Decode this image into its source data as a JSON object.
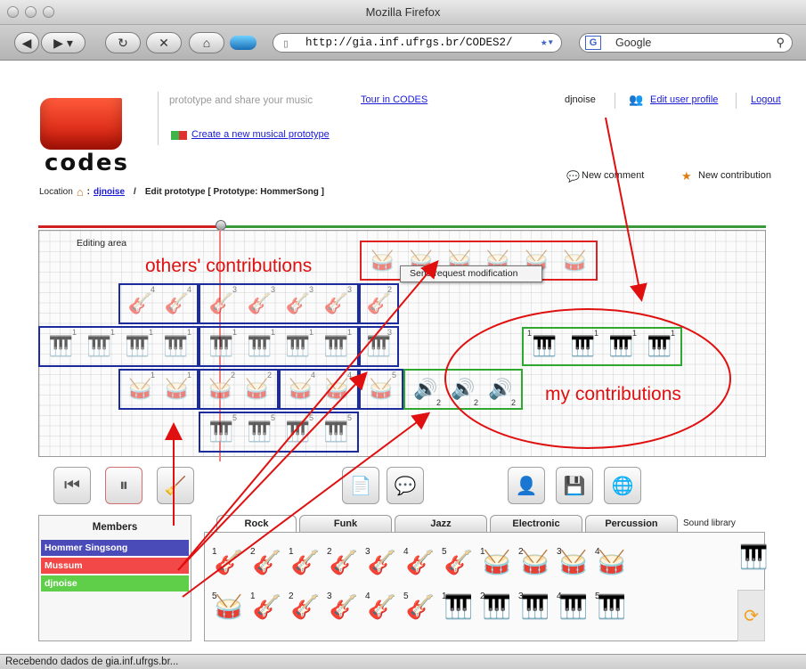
{
  "window": {
    "title": "Mozilla Firefox"
  },
  "browser": {
    "url": "http://gia.inf.ufrgs.br/CODES2/",
    "search_placeholder": "Google"
  },
  "header": {
    "tagline": "prototype and share your music",
    "tour_link": "Tour in CODES",
    "create_link": "Create a new musical prototype",
    "username": "djnoise",
    "edit_profile": "Edit user profile",
    "logout": "Logout",
    "logo_text": "codes",
    "new_comment": "New comment",
    "new_contribution": "New contribution"
  },
  "breadcrumb": {
    "location_label": "Location",
    "sep": ":",
    "user": "djnoise",
    "slash": "/",
    "page": "Edit prototype [ Prototype: HommerSong ]"
  },
  "editor": {
    "area_label": "Editing area",
    "tooltip": "Send request modification"
  },
  "annotations": {
    "others": "others' contributions",
    "mine": "my contributions"
  },
  "numbers": {
    "n1": "1",
    "n2": "2",
    "n3": "3",
    "n4": "4",
    "n5": "5"
  },
  "members": {
    "title": "Members",
    "list": [
      {
        "name": "Hommer Singsong",
        "color": "#4a4ab8"
      },
      {
        "name": "Mussum",
        "color": "#f24848"
      },
      {
        "name": "djnoise",
        "color": "#5fcf4a"
      }
    ]
  },
  "tabs": [
    "Rock",
    "Funk",
    "Jazz",
    "Electronic",
    "Percussion"
  ],
  "sound_library_label": "Sound library",
  "library": {
    "row1": [
      {
        "icon": "guitar-icon",
        "n": "1"
      },
      {
        "icon": "guitar-icon",
        "n": "2"
      },
      {
        "icon": "guitar-icon",
        "n": "1"
      },
      {
        "icon": "guitar-icon",
        "n": "2"
      },
      {
        "icon": "guitar-icon",
        "n": "3"
      },
      {
        "icon": "guitar-icon",
        "n": "4"
      },
      {
        "icon": "guitar-icon",
        "n": "5"
      },
      {
        "icon": "drums-icon",
        "n": "1"
      },
      {
        "icon": "drums-icon",
        "n": "2"
      },
      {
        "icon": "drums-icon",
        "n": "3"
      },
      {
        "icon": "drums-icon",
        "n": "4"
      }
    ],
    "row2": [
      {
        "icon": "drums-icon",
        "n": "5"
      },
      {
        "icon": "guitar-icon",
        "n": "1"
      },
      {
        "icon": "guitar-icon",
        "n": "2"
      },
      {
        "icon": "guitar-icon",
        "n": "3"
      },
      {
        "icon": "guitar-icon",
        "n": "4"
      },
      {
        "icon": "guitar-icon",
        "n": "5"
      },
      {
        "icon": "piano-icon",
        "n": "1"
      },
      {
        "icon": "piano-icon",
        "n": "2"
      },
      {
        "icon": "piano-icon",
        "n": "3"
      },
      {
        "icon": "piano-icon",
        "n": "4"
      },
      {
        "icon": "piano-icon",
        "n": "5"
      }
    ]
  },
  "status": "Recebendo dados de gia.inf.ufrgs.br..."
}
